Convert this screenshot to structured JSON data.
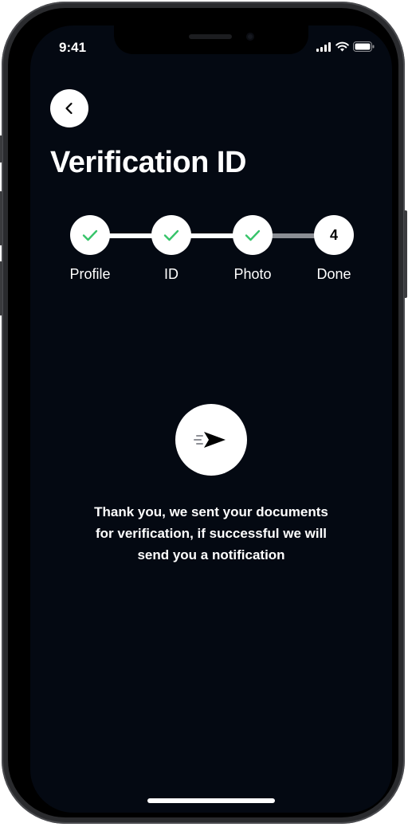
{
  "status_bar": {
    "time": "9:41",
    "icons": [
      "cellular-signal-icon",
      "wifi-icon",
      "battery-icon"
    ]
  },
  "header": {
    "back_icon": "chevron-left-icon",
    "title": "Verification ID"
  },
  "stepper": {
    "steps": [
      {
        "label": "Profile",
        "state": "done",
        "icon": "check-icon"
      },
      {
        "label": "ID",
        "state": "done",
        "icon": "check-icon"
      },
      {
        "label": "Photo",
        "state": "done",
        "icon": "check-icon"
      },
      {
        "label": "Done",
        "state": "current",
        "number": "4"
      }
    ]
  },
  "confirmation": {
    "icon": "paper-plane-send-icon",
    "lines": [
      "Thank you, we sent your documents",
      "for verification, if successful we will",
      "send you a notification"
    ]
  },
  "colors": {
    "background": "#040912",
    "accent_check": "#37c46a",
    "surface": "#ffffff",
    "line_complete": "#ffffff",
    "line_pending": "#8a8d93"
  }
}
